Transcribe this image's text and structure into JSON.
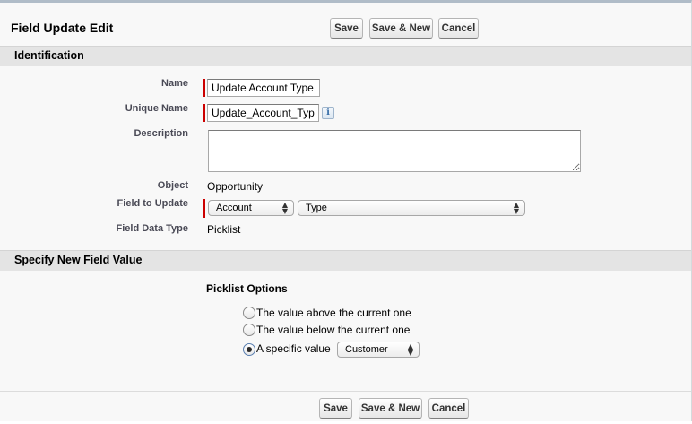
{
  "header": {
    "title": "Field Update Edit",
    "save_label": "Save",
    "save_new_label": "Save & New",
    "cancel_label": "Cancel"
  },
  "identification": {
    "section_title": "Identification",
    "name_label": "Name",
    "name_value": "Update Account Type",
    "unique_name_label": "Unique Name",
    "unique_name_value": "Update_Account_Type",
    "info_icon_glyph": "i",
    "description_label": "Description",
    "description_value": "",
    "object_label": "Object",
    "object_value": "Opportunity",
    "field_to_update_label": "Field to Update",
    "field_object_selected": "Account",
    "field_field_selected": "Type",
    "field_data_type_label": "Field Data Type",
    "field_data_type_value": "Picklist"
  },
  "new_value": {
    "section_title": "Specify New Field Value",
    "picklist_options_heading": "Picklist Options",
    "options": [
      {
        "label": "The value above the current one",
        "checked": false
      },
      {
        "label": "The value below the current one",
        "checked": false
      },
      {
        "label": "A specific value",
        "checked": true
      }
    ],
    "specific_value_selected": "Customer"
  },
  "footer": {
    "save_label": "Save",
    "save_new_label": "Save & New",
    "cancel_label": "Cancel"
  },
  "colors": {
    "required_bar": "#cc0000",
    "section_header_bg": "#e4e4e4",
    "panel_bg": "#f8f8f8",
    "top_border": "#b0bcc8"
  },
  "icons": {
    "info": "info-icon",
    "select_arrows": "updown-arrows-icon",
    "resize": "resize-grip-icon"
  }
}
